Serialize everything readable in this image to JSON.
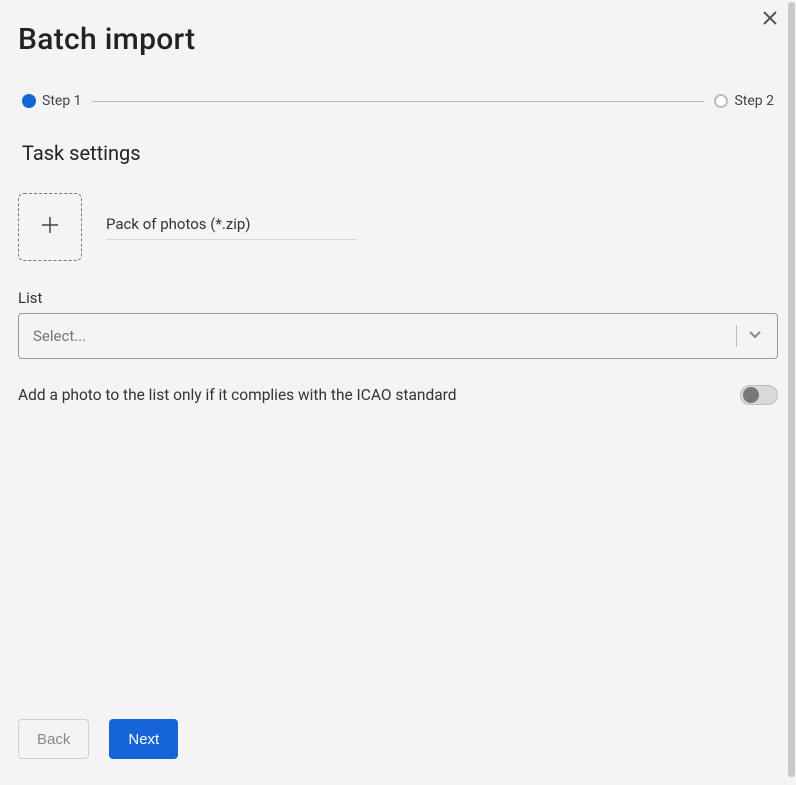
{
  "pageTitle": "Batch import",
  "stepper": {
    "step1Label": "Step 1",
    "step2Label": "Step 2"
  },
  "sectionTitle": "Task settings",
  "upload": {
    "label": "Pack of photos (*.zip)"
  },
  "listField": {
    "label": "List",
    "placeholder": "Select..."
  },
  "icaoToggle": {
    "label": "Add a photo to the list only if it complies with the ICAO standard",
    "value": false
  },
  "buttons": {
    "back": "Back",
    "next": "Next"
  }
}
